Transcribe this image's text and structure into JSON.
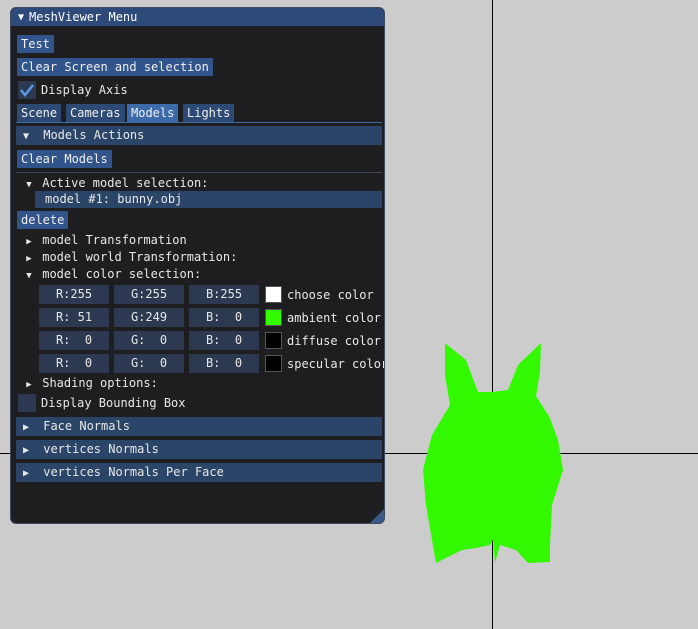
{
  "window": {
    "title": "MeshViewer Menu",
    "title_arrow": "▼"
  },
  "buttons": {
    "test": "Test",
    "clear_screen": "Clear Screen and selection",
    "clear_models": "Clear Models",
    "delete": "delete"
  },
  "display_axis": {
    "label": "Display Axis",
    "checked": true
  },
  "tabs": [
    {
      "label": "Scene"
    },
    {
      "label": "Cameras"
    },
    {
      "label": "Models",
      "active": true
    },
    {
      "label": "Lights"
    }
  ],
  "models_actions": {
    "arrow": "▼",
    "label": "Models Actions"
  },
  "active_selection": {
    "arrow": "▼",
    "label": "Active model selection:",
    "selected": "model #1: bunny.obj"
  },
  "tree": {
    "model_transformation": {
      "arrow": "▶",
      "label": "model Transformation"
    },
    "model_world_transformation": {
      "arrow": "▶",
      "label": "model world Transformation:"
    },
    "model_color_selection": {
      "arrow": "▼",
      "label": "model color selection:"
    },
    "shading_options": {
      "arrow": "▶",
      "label": "Shading options:"
    }
  },
  "colors": [
    {
      "r": "R:255",
      "g": "G:255",
      "b": "B:255",
      "swatch": "#ffffff",
      "label": "choose color"
    },
    {
      "r": "R: 51",
      "g": "G:249",
      "b": "B:  0",
      "swatch": "#33f900",
      "label": "ambient color"
    },
    {
      "r": "R:  0",
      "g": "G:  0",
      "b": "B:  0",
      "swatch": "#000000",
      "label": "diffuse color"
    },
    {
      "r": "R:  0",
      "g": "G:  0",
      "b": "B:  0",
      "swatch": "#000000",
      "label": "specular color"
    }
  ],
  "bounding_box": {
    "label": "Display Bounding Box",
    "checked": false
  },
  "sections": {
    "face_normals": {
      "arrow": "▶",
      "label": "Face Normals"
    },
    "vertices_normals": {
      "arrow": "▶",
      "label": "vertices Normals"
    },
    "vertices_normals_per_face": {
      "arrow": "▶",
      "label": "vertices Normals Per Face"
    }
  },
  "theme": {
    "viewport_bg": "#cccccc",
    "model_color": "#33f900",
    "accent": "#31548a"
  },
  "icons": [
    "collapse-triangle-icon",
    "expand-triangle-icon",
    "checkmark-icon",
    "resize-grip-icon"
  ]
}
